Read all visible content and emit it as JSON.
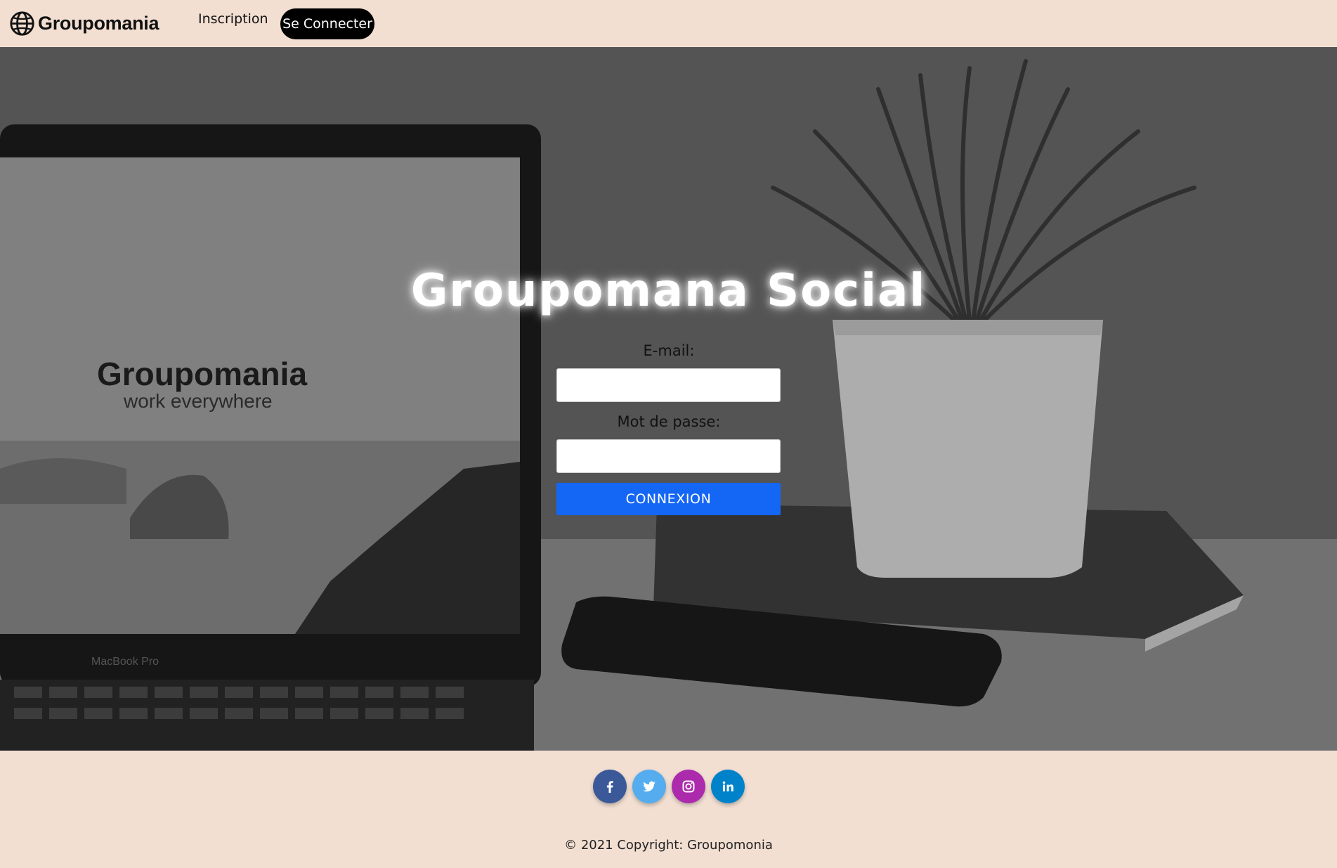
{
  "navbar": {
    "brand": "Groupomania",
    "links": {
      "signup": "Inscription",
      "login": "Se Connecter"
    }
  },
  "hero": {
    "title": "Groupomana Social",
    "laptop_brand": "Groupomania",
    "laptop_tagline": "work everywhere",
    "laptop_model": "MacBook Pro"
  },
  "form": {
    "email_label": "E-mail:",
    "email_value": "",
    "password_label": "Mot de passe:",
    "password_value": "",
    "submit_label": "CONNEXION"
  },
  "footer": {
    "socials": [
      {
        "name": "facebook",
        "icon": "facebook-icon",
        "color": "#3b5998"
      },
      {
        "name": "twitter",
        "icon": "twitter-icon",
        "color": "#55acee"
      },
      {
        "name": "instagram",
        "icon": "instagram-icon",
        "color": "#ac2bac"
      },
      {
        "name": "linkedin",
        "icon": "linkedin-icon",
        "color": "#0082ca"
      }
    ],
    "copyright": "© 2021 Copyright: Groupomonia"
  },
  "colors": {
    "page_bg": "#f2dfd2",
    "accent": "#1466f5",
    "nav_pill_bg": "#000000"
  }
}
